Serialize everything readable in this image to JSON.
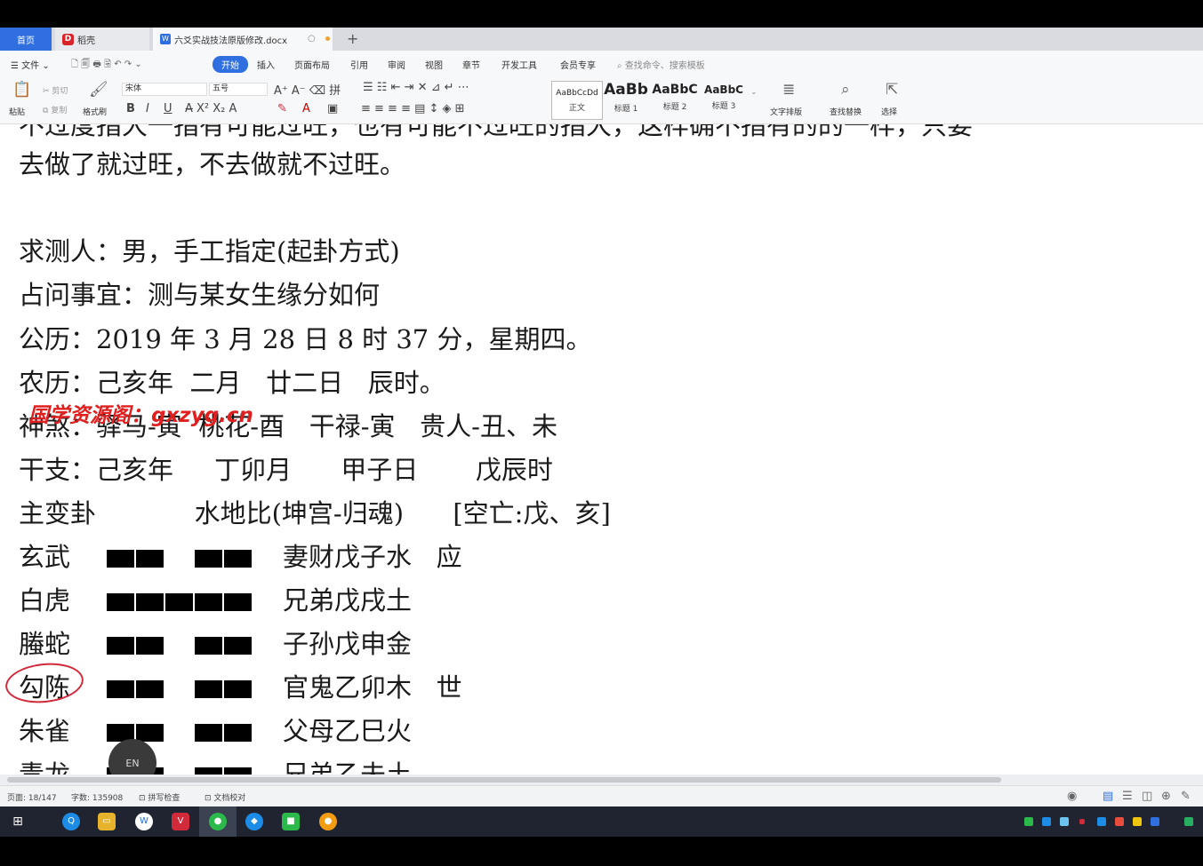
{
  "tabs": {
    "home": "首页",
    "daoke": "稻壳",
    "doc": "六爻实战技法原版修改.docx"
  },
  "menu": {
    "file": "文件",
    "items": [
      "开始",
      "插入",
      "页面布局",
      "引用",
      "审阅",
      "视图",
      "章节",
      "开发工具",
      "会员专享"
    ],
    "search": "查找命令、搜索模板"
  },
  "ribbon": {
    "paste": "粘贴",
    "cut": "剪切",
    "copy": "复制",
    "format_painter": "格式刷",
    "font": "宋体",
    "size": "五号",
    "styles": [
      {
        "sample": "AaBbCcDd",
        "name": "正文"
      },
      {
        "sample": "AaBb",
        "name": "标题 1"
      },
      {
        "sample": "AaBbC",
        "name": "标题 2"
      },
      {
        "sample": "AaBbC",
        "name": "标题 3"
      }
    ],
    "text_layout": "文字排版",
    "find_replace": "查找替换",
    "select": "选择"
  },
  "document": {
    "cut_line": "不过度指大一指有可能过旺，也有可能不过旺的指大，这样确不指有的的一样，只要",
    "lines": [
      "去做了就过旺，不去做就不过旺。",
      "求测人：男，手工指定(起卦方式)",
      "占问事宜：测与某女生缘分如何",
      "公历：2019 年 3 月 28 日 8 时 37 分，星期四。",
      "农历：己亥年  二月   廿二日   辰时。",
      "神煞：驿马-寅  桃花-酉   干禄-寅   贵人-丑、未",
      "干支：己亥年     丁卯月      甲子日       戊辰时",
      "主变卦            水地比(坤宫-归魂)      [空亡:戊、亥]"
    ],
    "yao": [
      {
        "spirit": "玄武",
        "type": "yin",
        "text": "妻财戊子水   应"
      },
      {
        "spirit": "白虎",
        "type": "yang",
        "text": "兄弟戊戌土"
      },
      {
        "spirit": "螣蛇",
        "type": "yin",
        "text": "子孙戊申金"
      },
      {
        "spirit": "勾陈",
        "type": "yin",
        "text": "官鬼乙卯木   世"
      },
      {
        "spirit": "朱雀",
        "type": "yin",
        "text": "父母乙巳火"
      },
      {
        "spirit": "青龙",
        "type": "yin",
        "text": "兄弟乙未土"
      }
    ]
  },
  "watermark": "国学资源阁：gxzyg.cn",
  "ime": "EN",
  "status": {
    "page": "页面: 18/147",
    "words": "字数: 135908",
    "spell": "拼写检查",
    "proof": "文档校对"
  },
  "colors": {
    "accent": "#2f6fe0",
    "watermark": "#e01f1f",
    "annotation": "#d12a3a"
  }
}
